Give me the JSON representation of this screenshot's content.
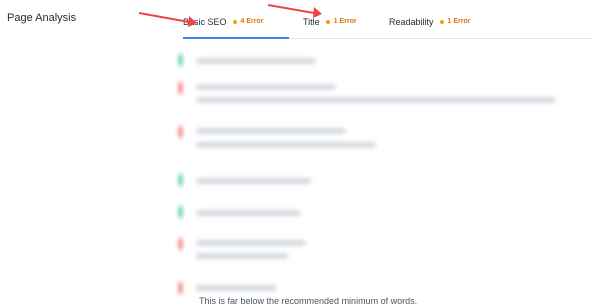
{
  "page": {
    "title": "Page Analysis"
  },
  "tabs": [
    {
      "label": "Basic SEO",
      "badge": "4 Error",
      "active": true
    },
    {
      "label": "Title",
      "badge": "1 Error",
      "active": false
    },
    {
      "label": "Readability",
      "badge": "1 Error",
      "active": false
    }
  ],
  "colors": {
    "active_underline": "#3b82f6",
    "error_badge": "#d97706",
    "arrow": "#ef4444",
    "pass_status": "#10b981",
    "fail_status": "#ef4444"
  },
  "results": [
    {
      "status": "pass"
    },
    {
      "status": "fail"
    },
    {
      "status": "fail"
    },
    {
      "status": "pass"
    },
    {
      "status": "pass"
    },
    {
      "status": "fail"
    },
    {
      "status": "fail"
    }
  ],
  "footer": {
    "visible_text": "This is far below the recommended minimum of words."
  }
}
